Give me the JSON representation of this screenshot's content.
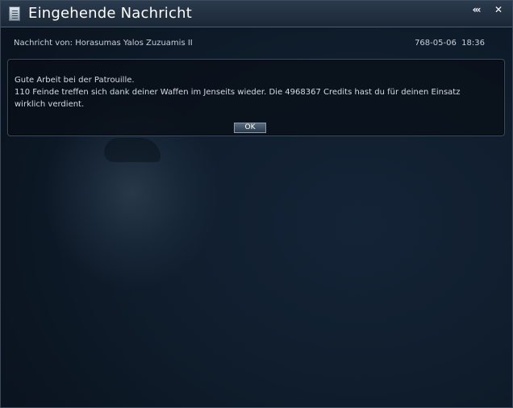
{
  "window": {
    "title": "Eingehende Nachricht",
    "collapse_label": "‹‹‹",
    "close_label": "✕"
  },
  "message": {
    "sender_line": "Nachricht von: Horasumas Yalos Zuzuamis II",
    "date": "768-05-06  18:36",
    "body_lines": [
      "Gute Arbeit bei der Patrouille.",
      "110 Feinde treffen sich dank deiner Waffen im Jenseits wieder. Die 4968367 Credits hast du für deinen Einsatz wirklich verdient."
    ],
    "ok_label": "OK"
  },
  "colors": {
    "background": "#0c1622",
    "panel_border": "#3c4b5c",
    "text": "#c9d2dc",
    "title_text": "#ffffff"
  },
  "icons": [
    "document-icon",
    "collapse-icon",
    "close-icon"
  ]
}
